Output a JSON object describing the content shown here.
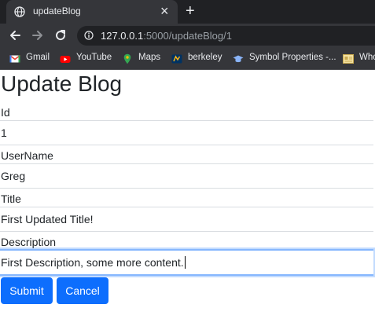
{
  "browser": {
    "tab": {
      "title": "updateBlog",
      "favicon": "globe-icon"
    },
    "url": {
      "host": "127.0.0.1",
      "path": ":5000/updateBlog/1"
    },
    "bookmarks": [
      {
        "label": "Gmail",
        "icon": "gmail-icon"
      },
      {
        "label": "YouTube",
        "icon": "youtube-icon"
      },
      {
        "label": "Maps",
        "icon": "maps-icon"
      },
      {
        "label": "berkeley",
        "icon": "berkeley-icon"
      },
      {
        "label": "Symbol Properties -...",
        "icon": "graduation-cap-icon"
      },
      {
        "label": "Who",
        "icon": "folder-icon"
      }
    ]
  },
  "page": {
    "title": "Update Blog",
    "fields": [
      {
        "label": "Id",
        "value": "1"
      },
      {
        "label": "UserName",
        "value": "Greg"
      },
      {
        "label": "Title",
        "value": "First Updated Title!"
      },
      {
        "label": "Description",
        "value": "First Description, some more content."
      }
    ],
    "buttons": {
      "submit": "Submit",
      "cancel": "Cancel"
    }
  },
  "colors": {
    "primary": "#0d6efd",
    "focus": "#86b7fe",
    "chrome_dark": "#202124",
    "chrome": "#35363a"
  }
}
